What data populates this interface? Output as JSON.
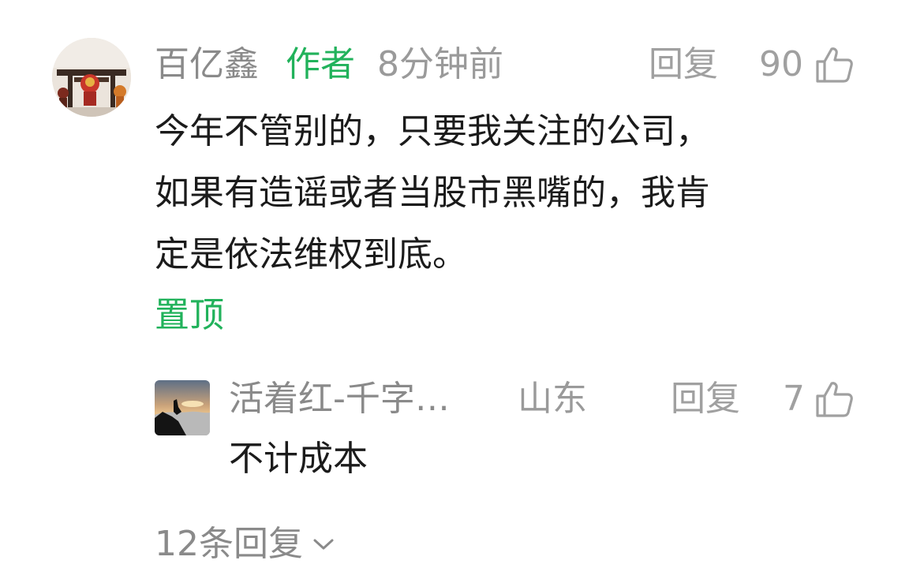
{
  "comment": {
    "username": "百亿鑫",
    "author_badge": "作者",
    "time_ago": "8分钟前",
    "reply_label": "回复",
    "like_count": "90",
    "text_lines": [
      "今年不管别的，只要我关注的公司，",
      "如果有造谣或者当股市黑嘴的，我肯",
      "定是依法维权到底。"
    ],
    "pinned_label": "置顶",
    "avatar_icon": "figurine-avatar",
    "like_icon": "thumbs-up-icon"
  },
  "reply": {
    "username": "活着红-千字…",
    "location": "山东",
    "reply_label": "回复",
    "like_count": "7",
    "text": "不计成本",
    "avatar_icon": "sunset-mountain-avatar"
  },
  "more_replies": {
    "label": "12条回复",
    "icon": "chevron-down-icon"
  },
  "colors": {
    "accent_green": "#21b25b",
    "meta_gray": "#8a8a8a",
    "text_dark": "#1b1b1b"
  }
}
